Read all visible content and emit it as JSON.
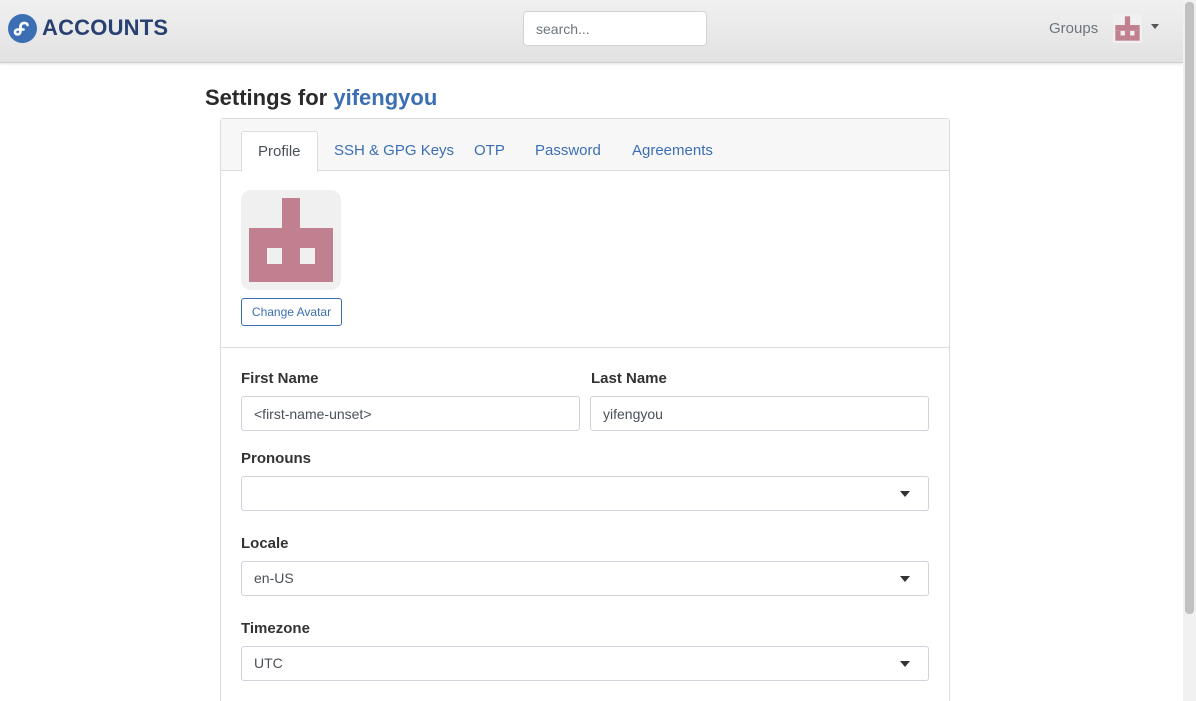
{
  "navbar": {
    "brand": "ACCOUNTS",
    "search_placeholder": "search...",
    "groups_label": "Groups"
  },
  "page": {
    "title_prefix": "Settings for",
    "username": "yifengyou"
  },
  "tabs": [
    {
      "label": "Profile",
      "active": true
    },
    {
      "label": "SSH & GPG Keys",
      "active": false
    },
    {
      "label": "OTP",
      "active": false
    },
    {
      "label": "Password",
      "active": false
    },
    {
      "label": "Agreements",
      "active": false
    }
  ],
  "avatar": {
    "change_label": "Change Avatar",
    "color": "#c08090"
  },
  "form": {
    "first_name_label": "First Name",
    "first_name_placeholder": "<first-name-unset>",
    "first_name_value": "",
    "last_name_label": "Last Name",
    "last_name_value": "yifengyou",
    "pronouns_label": "Pronouns",
    "pronouns_value": "",
    "locale_label": "Locale",
    "locale_value": "en-US",
    "timezone_label": "Timezone",
    "timezone_value": "UTC"
  },
  "colors": {
    "brand_blue": "#3c6eb4",
    "brand_dark": "#294172"
  }
}
